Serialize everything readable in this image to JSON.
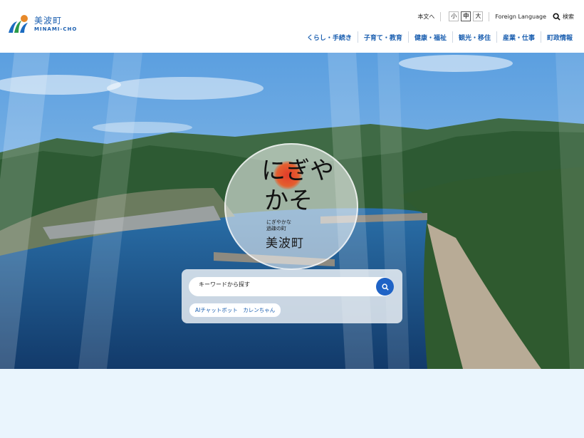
{
  "logo": {
    "name_jp": "美波町",
    "name_en": "MINAMI-CHO"
  },
  "util": {
    "skip_label": "本文へ",
    "font_sizes": [
      "小",
      "中",
      "大"
    ],
    "language_label": "Foreign Language",
    "search_label": "検索"
  },
  "nav": {
    "items": [
      "くらし・手続き",
      "子育て・教育",
      "健康・福祉",
      "観光・移住",
      "産業・仕事",
      "町政情報"
    ]
  },
  "hero": {
    "emblem": {
      "catch_line1": "にぎや",
      "catch_line2": "かそ",
      "sub_line1": "にぎやかな",
      "sub_line2": "過疎の町",
      "town": "美波町"
    },
    "search": {
      "placeholder": "キーワードから探す",
      "ai_button": "AIチャットボット　カレンちゃん"
    }
  },
  "colors": {
    "brand_blue": "#1b5fb0",
    "search_button": "#1f63c6",
    "page_bg": "#eaf5fd"
  },
  "icons": [
    "logo-mark-icon",
    "search-icon"
  ]
}
